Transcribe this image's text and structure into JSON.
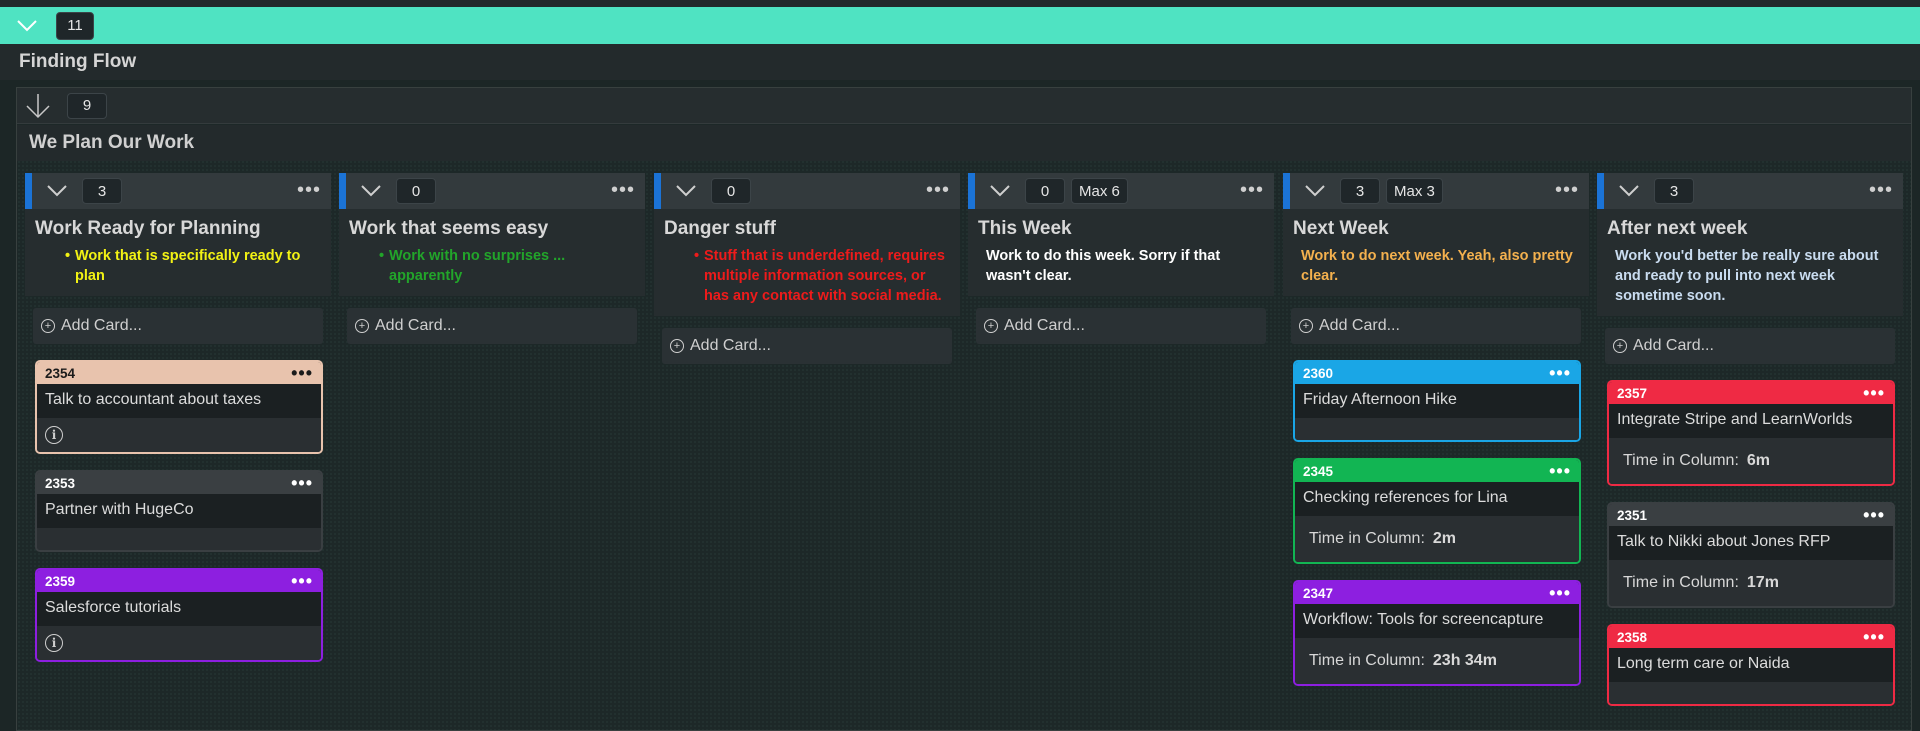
{
  "lane": {
    "count": "11",
    "title": "Finding Flow"
  },
  "sublane": {
    "count": "9",
    "title": "We Plan Our Work"
  },
  "add_label": "Add Card...",
  "time_label": "Time in Column:",
  "columns": [
    {
      "count": "3",
      "wip": "",
      "name": "Work Ready for Planning",
      "policy": "Work that is specifically ready to plan",
      "policy_color": "#f2f214",
      "cards": [
        {
          "id": "2354",
          "title": "Talk to accountant about taxes",
          "time": "",
          "color": "#e8c3ad",
          "head_text": "#1b1b1b"
        },
        {
          "id": "2353",
          "title": "Partner with HugeCo",
          "time": "",
          "color": "#3a3f42",
          "head_text": "#ffffff"
        },
        {
          "id": "2359",
          "title": "Salesforce tutorials",
          "time": "",
          "color": "#8d1fe0",
          "head_text": "#ffffff"
        }
      ]
    },
    {
      "count": "0",
      "wip": "",
      "name": "Work that seems easy",
      "policy": "Work with no surprises ... apparently",
      "policy_color": "#22a52a",
      "cards": []
    },
    {
      "count": "0",
      "wip": "",
      "name": "Danger stuff",
      "policy": "Stuff that is underdefined, requires multiple information sources, or has any contact with social media.",
      "policy_color": "#ee1b1b",
      "cards": []
    },
    {
      "count": "0",
      "wip": "Max 6",
      "name": "This Week",
      "policy": "Work to do this week. Sorry if that wasn't clear.",
      "policy_color": "#ffffff",
      "cards": []
    },
    {
      "count": "3",
      "wip": "Max 3",
      "name": "Next Week",
      "policy": "Work to do next week. Yeah, also pretty clear.",
      "policy_color": "#f4b14e",
      "cards": [
        {
          "id": "2360",
          "title": "Friday Afternoon Hike",
          "time": "",
          "color": "#1aa6e6",
          "head_text": "#ffffff"
        },
        {
          "id": "2345",
          "title": "Checking references for Lina",
          "time": "2m",
          "color": "#12b553",
          "head_text": "#ffffff"
        },
        {
          "id": "2347",
          "title": "Workflow: Tools for screencapture",
          "time": "23h 34m",
          "color": "#8d1fe0",
          "head_text": "#ffffff"
        }
      ]
    },
    {
      "count": "3",
      "wip": "",
      "name": "After next week",
      "policy": "Work you'd better be really sure about and ready to pull into next week sometime soon.",
      "policy_color": "#c9dcf0",
      "cards": [
        {
          "id": "2357",
          "title": "Integrate Stripe and LearnWorlds",
          "time": "6m",
          "color": "#ef2a44",
          "head_text": "#ffffff"
        },
        {
          "id": "2351",
          "title": "Talk to Nikki about Jones RFP",
          "time": "17m",
          "color": "#3a3f42",
          "head_text": "#ffffff"
        },
        {
          "id": "2358",
          "title": "Long term care or Naida",
          "time": "",
          "color": "#ef2a44",
          "head_text": "#ffffff"
        }
      ]
    }
  ]
}
